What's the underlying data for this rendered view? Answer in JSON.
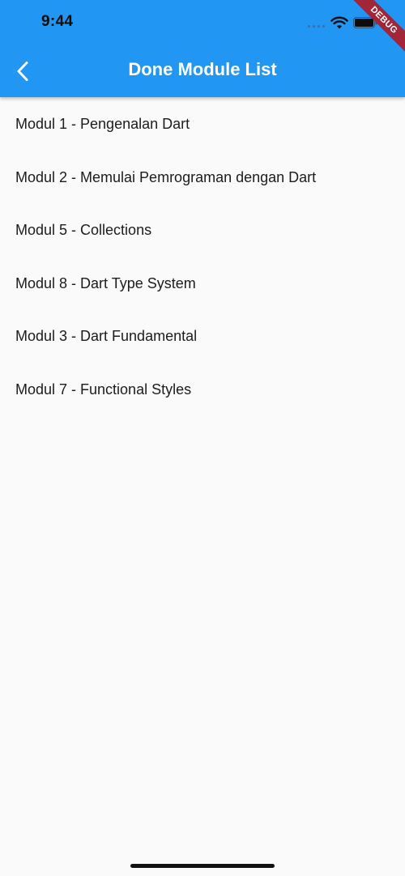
{
  "status_bar": {
    "time": "9:44"
  },
  "debug_banner": {
    "label": "DEBUG"
  },
  "app_bar": {
    "title": "Done Module List",
    "back_icon": "chevron-left-icon",
    "background_color": "#2196f3"
  },
  "modules": [
    {
      "label": "Modul 1 - Pengenalan Dart"
    },
    {
      "label": "Modul 2 - Memulai Pemrograman dengan Dart"
    },
    {
      "label": "Modul 5 - Collections"
    },
    {
      "label": "Modul 8 - Dart Type System"
    },
    {
      "label": "Modul 3 - Dart Fundamental"
    },
    {
      "label": "Modul 7 - Functional Styles"
    }
  ]
}
